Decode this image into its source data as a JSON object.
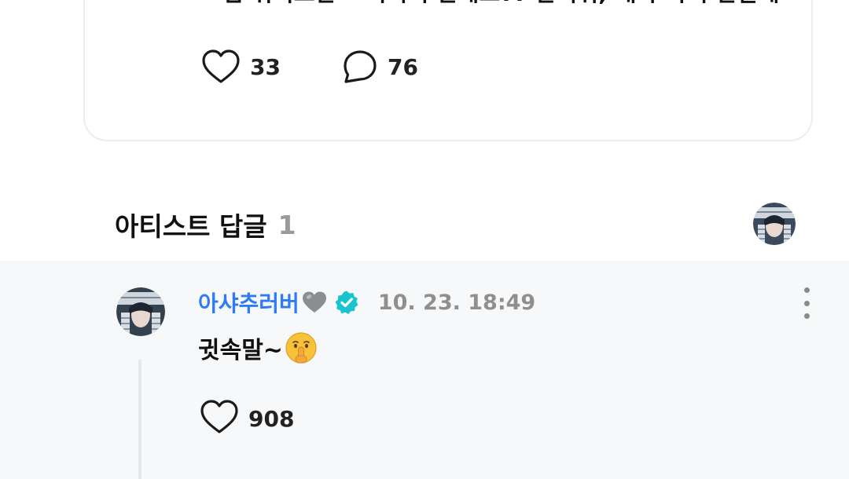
{
  "post": {
    "text": "그럼 위버스말고 어디서 말해요?? 알려줘, 내가 가서 말할게~",
    "like_count": "33",
    "comment_count": "76",
    "like_icon": "heart-outline-icon",
    "comment_icon": "speech-bubble-icon"
  },
  "artist_section": {
    "title": "아티스트 답글",
    "count": "1"
  },
  "reply": {
    "author": "아샤추러버",
    "author_emoji": "grey-heart-emoji",
    "verified_icon": "verified-badge-icon",
    "timestamp": "10. 23. 18:49",
    "text": "귓속말~",
    "text_emoji": "shushing-face-emoji",
    "like_count": "908",
    "more_icon": "more-vertical-icon"
  },
  "colors": {
    "author_blue": "#2f7bf5",
    "verified_teal": "#19c4cf",
    "muted_gray": "#8f8f8f",
    "reply_background": "#f7f8fa"
  }
}
